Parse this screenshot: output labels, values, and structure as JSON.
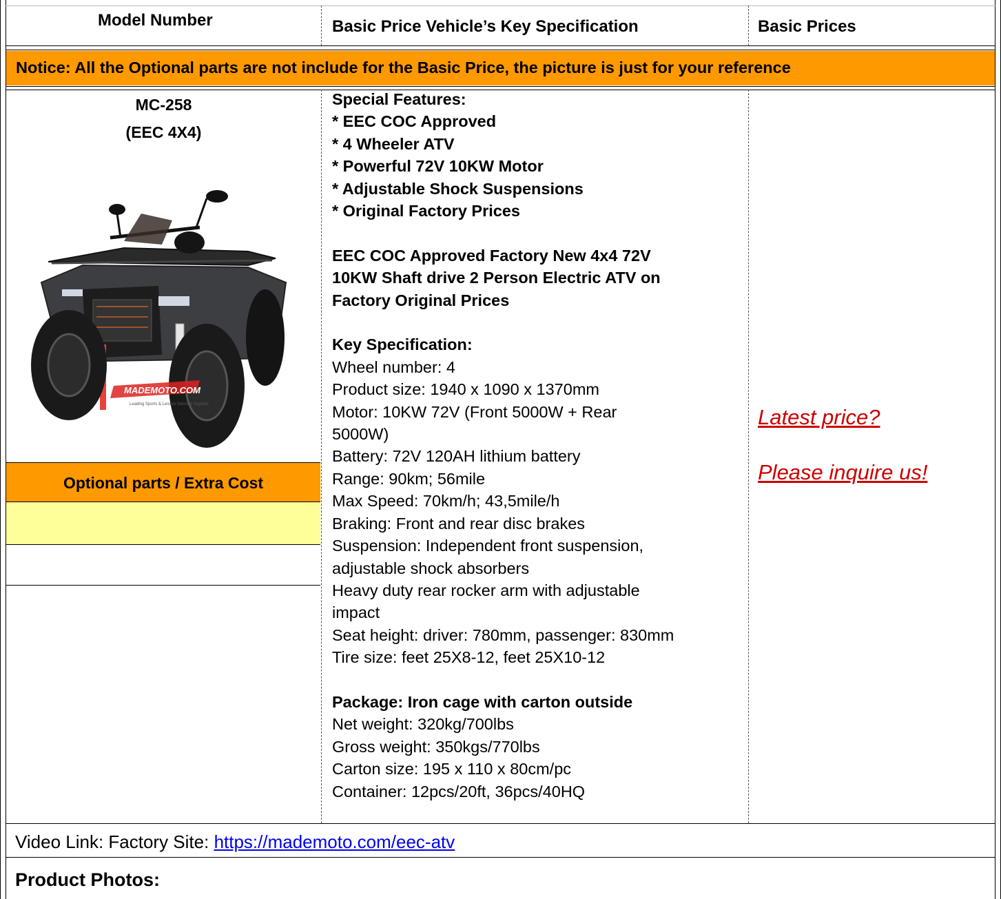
{
  "header": {
    "col1": "Model Number",
    "col2": "Basic Price Vehicle’s Key Specification",
    "col3": "Basic Prices"
  },
  "notice": "Notice: All the Optional parts are not include for the Basic Price, the picture is just for your reference",
  "model": {
    "number": "MC-258",
    "variant": "(EEC 4X4)",
    "watermark": "MADEMOTO.COM",
    "watermark_sub": "Leading Sports & Leisure Vehicles Supplier"
  },
  "optional": {
    "title": "Optional parts / Extra Cost"
  },
  "spec": {
    "features_title": "Special Features:",
    "features": [
      "* EEC COC Approved",
      "* 4 Wheeler ATV",
      "* Powerful 72V 10KW Motor",
      "* Adjustable Shock Suspensions",
      "* Original Factory Prices"
    ],
    "headline": [
      "EEC COC Approved Factory New 4x4 72V",
      "10KW Shaft drive 2 Person Electric ATV on",
      "Factory Original Prices"
    ],
    "key_title": "Key Specification:",
    "key_lines": [
      "Wheel number: 4",
      "Product size: 1940 x 1090 x 1370mm",
      "Motor: 10KW 72V (Front 5000W + Rear",
      "5000W)",
      "Battery: 72V 120AH lithium battery",
      "Range: 90km; 56mile",
      "Max Speed: 70km/h; 43,5mile/h",
      "Braking: Front and rear disc brakes",
      "Suspension: Independent front suspension,",
      "adjustable shock absorbers",
      "Heavy duty rear rocker arm with adjustable",
      "impact",
      "Seat height: driver: 780mm, passenger: 830mm",
      "Tire size: feet 25X8-12, feet 25X10-12"
    ],
    "package_title": "Package: Iron cage with carton outside",
    "package_lines": [
      "Net weight: 320kg/700lbs",
      "Gross weight: 350kgs/770lbs",
      "Carton size: 195 x 110 x 80cm/pc",
      "Container: 12pcs/20ft, 36pcs/40HQ"
    ]
  },
  "price": {
    "line1": "Latest price? ",
    "line2": "Please inquire us!"
  },
  "footer": {
    "video_prefix": "Video Link: Factory Site: ",
    "video_url": "https://mademoto.com/eec-atv",
    "photos_title": "Product Photos:"
  },
  "colors": {
    "orange": "#ff9900",
    "yellow": "#ffff99",
    "price_red": "#cc0000",
    "link_blue": "#0000ee"
  }
}
